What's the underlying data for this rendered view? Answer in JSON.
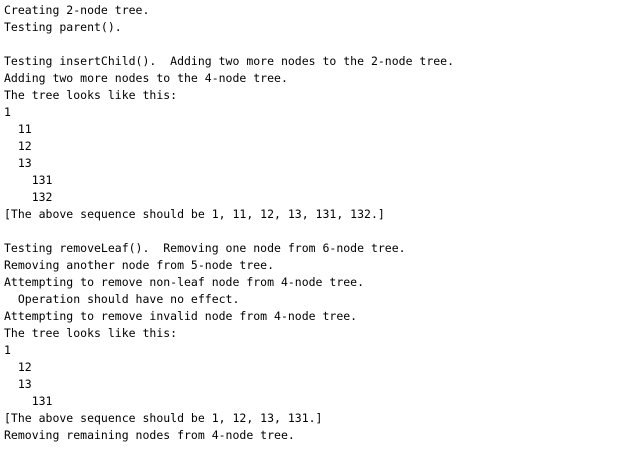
{
  "console": {
    "lines": [
      "Creating 2-node tree.",
      "Testing parent().",
      "",
      "Testing insertChild().  Adding two more nodes to the 2-node tree.",
      "Adding two more nodes to the 4-node tree.",
      "The tree looks like this:",
      "1",
      "  11",
      "  12",
      "  13",
      "    131",
      "    132",
      "[The above sequence should be 1, 11, 12, 13, 131, 132.]",
      "",
      "Testing removeLeaf().  Removing one node from 6-node tree.",
      "Removing another node from 5-node tree.",
      "Attempting to remove non-leaf node from 4-node tree.",
      "  Operation should have no effect.",
      "Attempting to remove invalid node from 4-node tree.",
      "The tree looks like this:",
      "1",
      "  12",
      "  13",
      "    131",
      "[The above sequence should be 1, 12, 13, 131.]",
      "Removing remaining nodes from 4-node tree."
    ]
  }
}
